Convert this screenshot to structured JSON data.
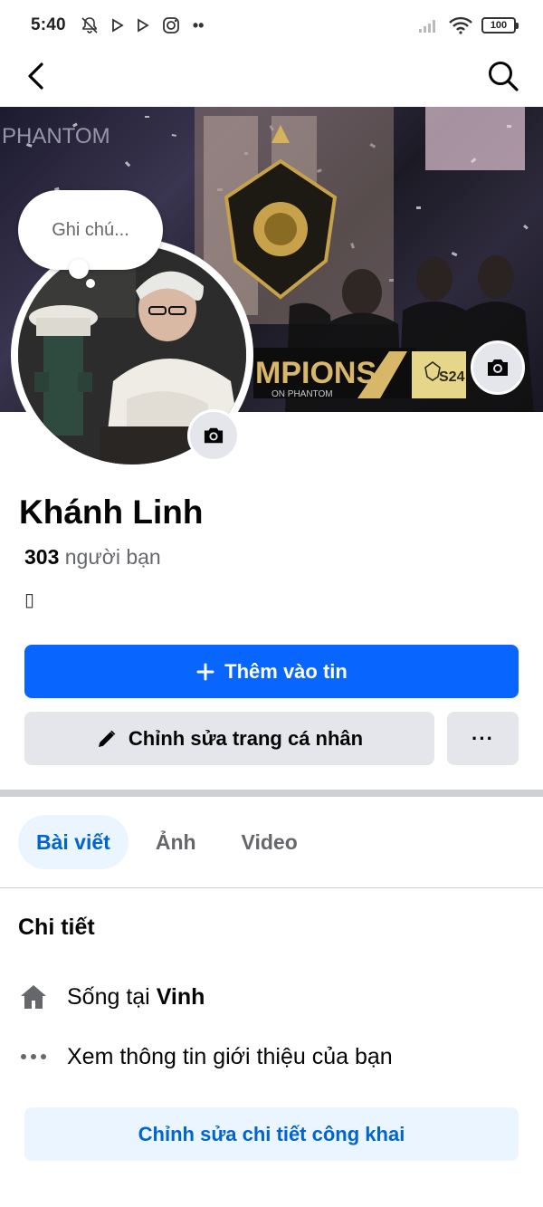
{
  "status_bar": {
    "time": "5:40",
    "battery": "100"
  },
  "note": {
    "placeholder": "Ghi chú..."
  },
  "cover": {
    "banner_text": "CHAMPIONS",
    "banner_sub": "ON PHANTOM",
    "season_badge": "S24",
    "watermark": "PHANTOM"
  },
  "profile": {
    "name": "Khánh Linh",
    "friends_count": "303",
    "friends_label": "người bạn",
    "bio_glyph": "▯"
  },
  "actions": {
    "add_story": "Thêm vào tin",
    "edit_profile": "Chỉnh sửa trang cá nhân",
    "more": "···"
  },
  "tabs": [
    {
      "label": "Bài viết",
      "active": true
    },
    {
      "label": "Ảnh",
      "active": false
    },
    {
      "label": "Video",
      "active": false
    }
  ],
  "details": {
    "title": "Chi tiết",
    "lives_in_prefix": "Sống tại",
    "lives_in_city": "Vinh",
    "see_about": "Xem thông tin giới thiệu của bạn",
    "edit_public": "Chỉnh sửa chi tiết công khai"
  },
  "colors": {
    "primary": "#0866ff",
    "secondary_bg": "#e4e6eb",
    "tab_active_bg": "#ebf5ff",
    "tab_active_text": "#0064d1",
    "text_muted": "#65676b"
  }
}
